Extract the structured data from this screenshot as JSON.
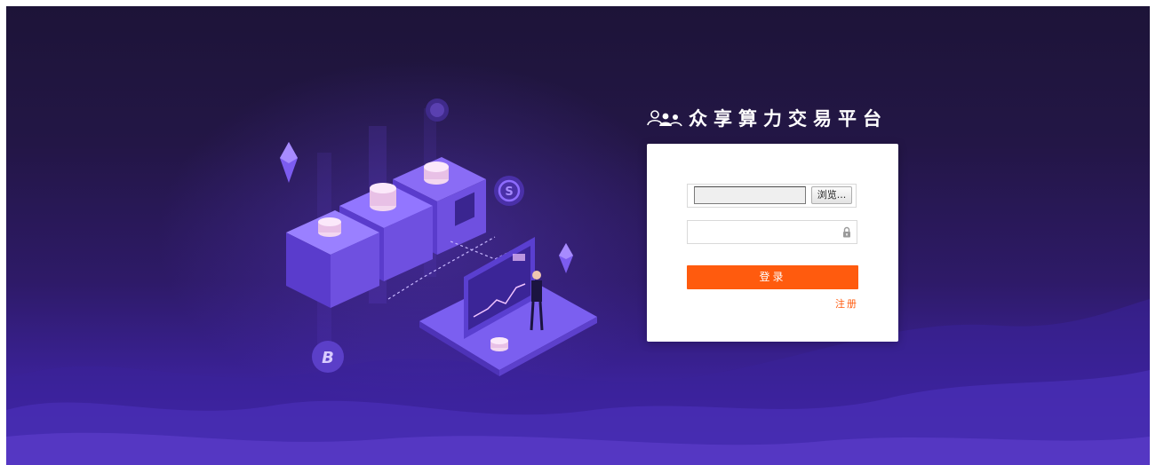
{
  "brand": {
    "title": "众享算力交易平台",
    "logo_icon": "users-icon"
  },
  "login_form": {
    "file_input": {
      "value": "",
      "browse_label": "浏览..."
    },
    "password": {
      "value": "",
      "placeholder": "",
      "icon": "lock-icon"
    },
    "submit_label": "登录",
    "register_label": "注册"
  },
  "decor": {
    "coins": [
      "ethereum-icon",
      "bitcoin-icon",
      "dollar-coin-icon"
    ]
  },
  "colors": {
    "accent": "#ff5b0e",
    "background_top": "#1d1438",
    "background_bottom": "#4a2bb8",
    "card": "#ffffff"
  }
}
